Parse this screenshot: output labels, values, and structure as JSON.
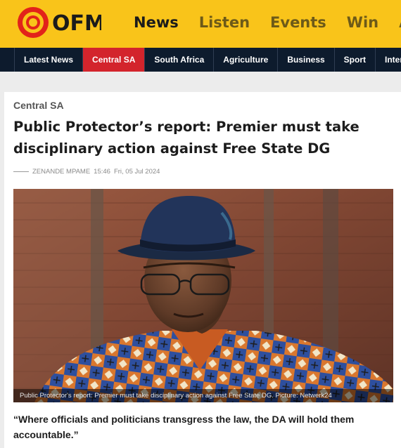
{
  "brand": {
    "logo_text": "OFM",
    "accent_yellow": "#f9c41a",
    "accent_red": "#d3242c",
    "nav_dark": "#0d1b2d"
  },
  "main_nav": [
    {
      "label": "News",
      "active": true
    },
    {
      "label": "Listen",
      "active": false
    },
    {
      "label": "Events",
      "active": false
    },
    {
      "label": "Win",
      "active": false
    },
    {
      "label": "Adv",
      "active": false
    }
  ],
  "sub_nav": [
    {
      "label": "Latest News",
      "active": false
    },
    {
      "label": "Central SA",
      "active": true
    },
    {
      "label": "South Africa",
      "active": false
    },
    {
      "label": "Agriculture",
      "active": false
    },
    {
      "label": "Business",
      "active": false
    },
    {
      "label": "Sport",
      "active": false
    },
    {
      "label": "Intern",
      "active": false
    }
  ],
  "article": {
    "category": "Central SA",
    "headline": "Public Protector’s report: Premier must take disciplinary action against Free State DG",
    "author": "ZENANDE MPAME",
    "time": "15:46",
    "date": "Fri, 05 Jul 2024",
    "image_caption": "Public Protector's report: Premier must take disciplinary action against Free State DG. Picture: Netwerk24",
    "quote": "“Where officials and politicians transgress the law, the DA will hold them accountable.”"
  }
}
